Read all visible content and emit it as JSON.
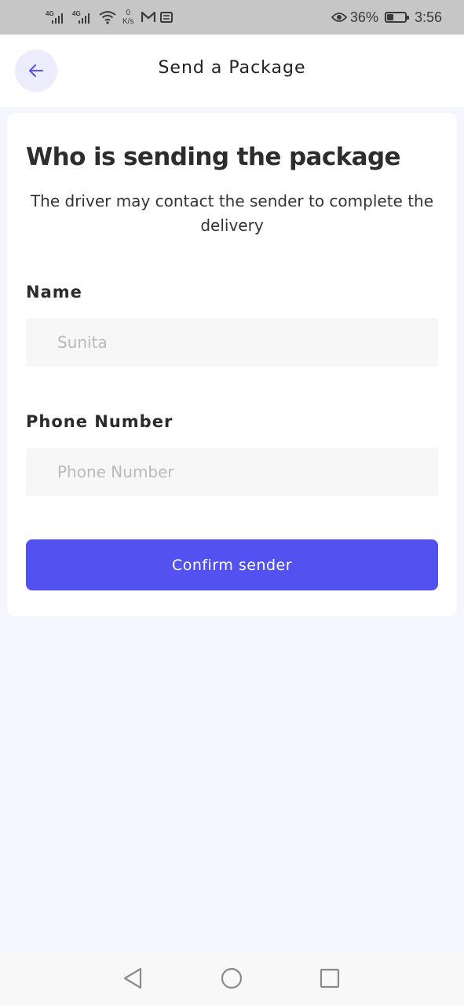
{
  "status_bar": {
    "network_1": "4G",
    "network_2": "4G",
    "speed_value": "0",
    "speed_unit": "K/s",
    "battery_percent": "36%",
    "battery_level": 0.36,
    "time": "3:56",
    "icons": [
      "signal-icon",
      "signal-icon",
      "wifi-icon",
      "gmail-icon",
      "message-icon",
      "eye-icon",
      "battery-icon"
    ]
  },
  "header": {
    "title": "Send a Package",
    "back_icon": "arrow-left-icon"
  },
  "form": {
    "title": "Who is sending the package",
    "subtitle": "The driver may contact the sender to complete the delivery",
    "name_label": "Name",
    "name_placeholder": "Sunita",
    "name_value": "",
    "phone_label": "Phone Number",
    "phone_placeholder": "Phone Number",
    "phone_value": "",
    "confirm_label": "Confirm sender"
  },
  "nav_bar": {
    "buttons": [
      "back-triangle-icon",
      "home-circle-icon",
      "recents-square-icon"
    ]
  },
  "colors": {
    "accent": "#5351f0",
    "back_button_bg": "#ececfd",
    "page_bg": "#f4f5fe",
    "status_bar_bg": "#c6c6c6"
  }
}
